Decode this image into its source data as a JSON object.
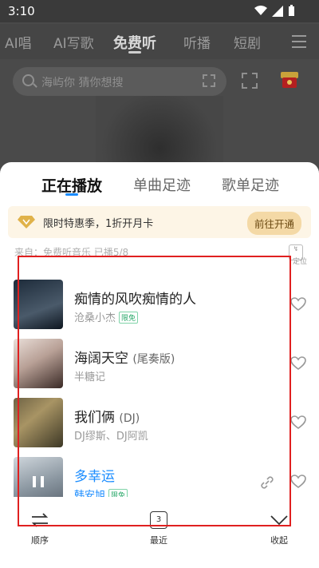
{
  "status_bar": {
    "time": "3:10"
  },
  "top_nav": {
    "tabs": [
      "AI唱",
      "AI写歌",
      "免费听",
      "听播",
      "短剧"
    ],
    "active_index": 2
  },
  "search": {
    "placeholder": "海屿你 猜你想搜"
  },
  "now_playing_sheet": {
    "tabs": [
      "正在播放",
      "单曲足迹",
      "歌单足迹"
    ],
    "active_tab": 0,
    "vip_banner": {
      "text": "限时特惠季，1折开月卡",
      "button": "前往开通"
    },
    "source": "来自：免费听音乐 已播5/8",
    "locate_label": "定位",
    "songs": [
      {
        "title": "痴情的风吹痴情的人",
        "subtitle": "",
        "artist": "沧桑小杰",
        "badge": "限免",
        "active": false
      },
      {
        "title": "海阔天空",
        "subtitle": "(尾奏版)",
        "artist": "半糖记",
        "badge": "",
        "active": false
      },
      {
        "title": "我们俩",
        "subtitle": "(DJ)",
        "artist": "DJ缪斯、DJ阿凯",
        "badge": "",
        "active": false
      },
      {
        "title": "多幸运",
        "subtitle": "",
        "artist": "韩安旭",
        "badge": "限免",
        "active": true
      }
    ],
    "bottom_bar": {
      "order_label": "顺序",
      "recent_label": "最近",
      "recent_count": "3",
      "collapse_label": "收起"
    }
  },
  "colors": {
    "accent": "#1a8cff",
    "highlight_box": "#e02020",
    "vip_button": "#f4d9a6"
  }
}
